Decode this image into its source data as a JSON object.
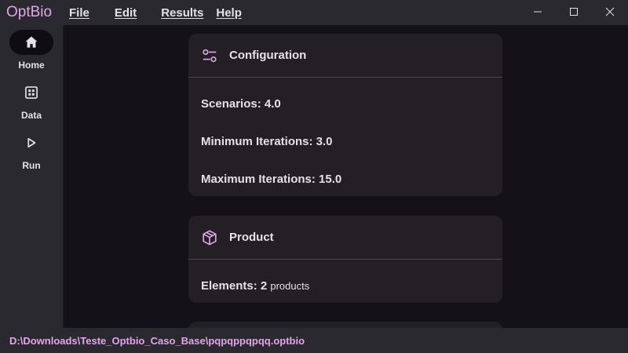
{
  "app": {
    "name": "OptBio"
  },
  "menu": {
    "file": "File",
    "edit": "Edit",
    "results": "Results",
    "help": "Help"
  },
  "sidebar": {
    "items": [
      {
        "label": "Home",
        "icon": "home-icon",
        "active": true
      },
      {
        "label": "Data",
        "icon": "grid-icon",
        "active": false
      },
      {
        "label": "Run",
        "icon": "play-icon",
        "active": false
      }
    ]
  },
  "config_card": {
    "title": "Configuration",
    "icon": "sliders-icon",
    "rows": [
      {
        "text": "Scenarios: 4.0"
      },
      {
        "text": "Minimum Iterations: 3.0"
      },
      {
        "text": "Maximum Iterations: 15.0"
      }
    ]
  },
  "product_card": {
    "title": "Product",
    "icon": "package-icon",
    "elements_label": "Elements: 2",
    "elements_unit": "products"
  },
  "status": {
    "path": "D:\\Downloads\\Teste_Optbio_Caso_Base\\pqpqppqpqq.optbio"
  },
  "colors": {
    "accent": "#e0a6e8",
    "surface": "#2b2930",
    "background": "#141218",
    "card": "#231f25",
    "text": "#e6e1e5"
  }
}
